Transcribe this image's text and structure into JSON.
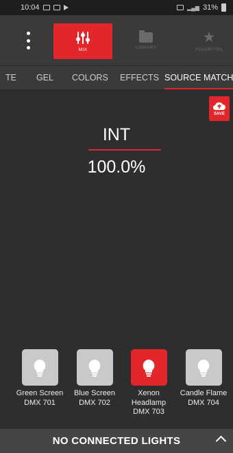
{
  "status_bar": {
    "time": "10:04",
    "battery": "31%"
  },
  "nav": {
    "mix_label": "MIX",
    "library_label": "LIBRARY",
    "favorites_label": "FAVORITES"
  },
  "subtabs": [
    {
      "label": "TE"
    },
    {
      "label": "GEL"
    },
    {
      "label": "COLORS"
    },
    {
      "label": "EFFECTS"
    },
    {
      "label": "SOURCE MATCH",
      "active": true
    }
  ],
  "save_label": "SAVE",
  "intensity": {
    "label": "INT",
    "value": "100.0%"
  },
  "presets": [
    {
      "name": "Green Screen",
      "dmx": "DMX 701",
      "active": false
    },
    {
      "name": "Blue Screen",
      "dmx": "DMX 702",
      "active": false
    },
    {
      "name": "Xenon Headlamp",
      "dmx": "DMX 703",
      "active": true
    },
    {
      "name": "Candle Flame",
      "dmx": "DMX 704",
      "active": false
    }
  ],
  "bottom_bar": {
    "text": "NO CONNECTED LIGHTS"
  },
  "colors": {
    "accent": "#e3262b",
    "background": "#2e2e2e",
    "inactive_tile": "#c9c9c9"
  },
  "icons": {
    "menu": "more-vertical-icon",
    "mix": "sliders-icon",
    "library": "folder-icon",
    "favorites": "star-icon",
    "save": "cloud-upload-icon",
    "preset": "light-bulb-icon",
    "expand": "chevron-up-icon"
  }
}
